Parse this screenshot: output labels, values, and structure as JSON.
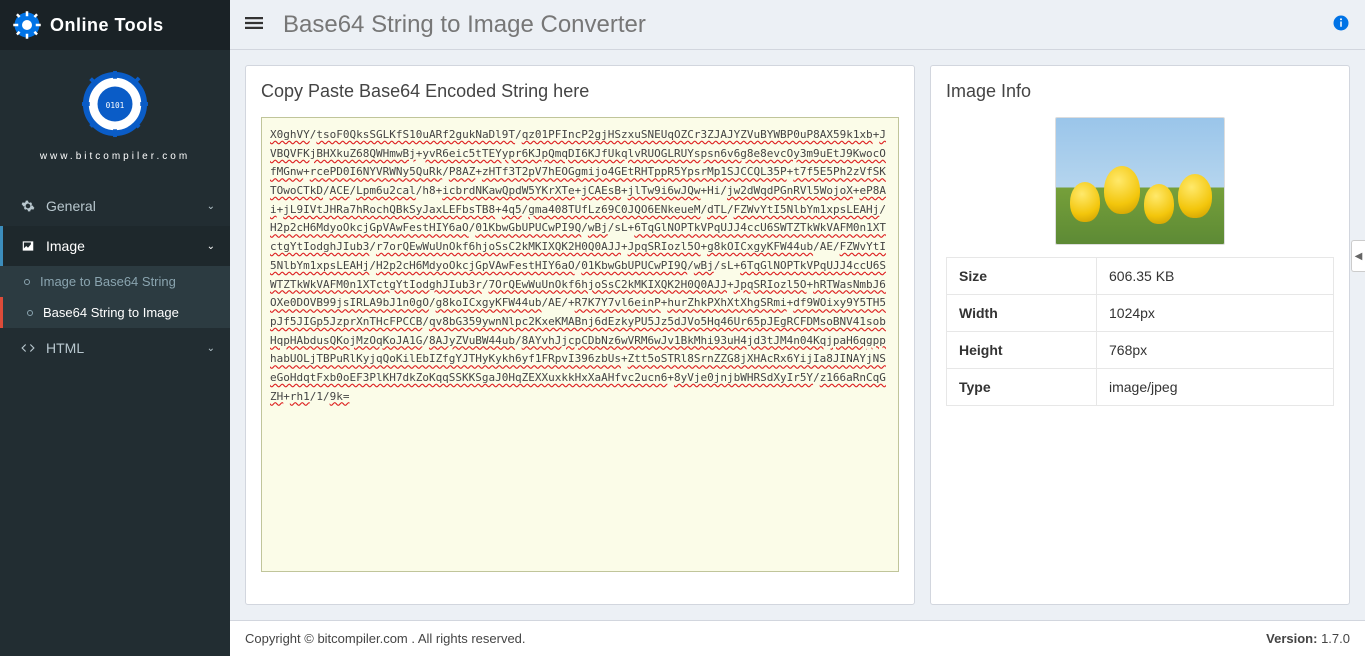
{
  "brand": "Online Tools",
  "site_url": "www.bitcompiler.com",
  "page_title": "Base64 String to Image Converter",
  "sidebar": {
    "items": [
      {
        "label": "General",
        "icon": "gear-icon"
      },
      {
        "label": "Image",
        "icon": "image-icon"
      },
      {
        "label": "HTML",
        "icon": "code-icon"
      }
    ],
    "image_children": [
      {
        "label": "Image to Base64 String"
      },
      {
        "label": "Base64 String to Image"
      }
    ]
  },
  "left_panel": {
    "title": "Copy Paste Base64 Encoded String here",
    "value": "X0ghVY/tsoF0QksSGLKfS10uARf2gukNaDl9T/qz01PFIncP2gjHSzxuSNEUqOZCr3ZJAJYZVuBYWBP0uP8AX59k1xb+JVBQVFKjBHXkuZ68QWHmwBj+yvR6eic5tTEYypr6KJpQmqDI6KJfUkqlvRUOGLRUYspsn6v6g8e8evcOy3m9uEtJ9KwocOfMGnw+rcePD0I6NYVRWNy5QuRk/P8AZ+zHTf3T2pV7hEOGgmijo4GEtRHTppR5YpsrMp1SJCCQL35P+t7f5E5Ph2zVfSKTOwoCTkD/ACE/Lpm6u2cal/h8+icbrdNKawQpdW5YKrXTe+jCAEsB+jlTw9i6wJQw+Hi/jw2dWqdPGnRVl5WojoX+eP8Ai+jL9IVtJHRa7hRochQBkSyJaxLEFbsTB8+4q5/gma408TUfLz69C0JQO6ENkeueM/dTL/FZWvYtI5NlbYm1xpsLEAHj/H2p2cH6MdyoOkcjGpVAwFestHIY6aO/01KbwGbUPUCwPI9Q/wBj/sL+6TqGlNOPTkVPqUJJ4ccU6SWTZTkWkVAFM0n1XTctgYtIodghJIub3/r7orQEwWuUnOkf6hjoSsC2kMKIXQK2H0Q0AJJ+JpqSRIozl5O+g8kOICxgyKFW44ub/AE/FZWvYtI5NlbYm1xpsLEAHj/H2p2cH6MdyoOkcjGpVAwFestHIY6aO/01KbwGbUPUCwPI9Q/wBj/sL+6TqGlNOPTkVPqUJJ4ccU6SWTZTkWkVAFM0n1XTctgYtIodghJIub3r/7OrQEwWuUnOkf6hjoSsC2kMKIXQK2H0Q0AJJ+JpqSRIozl5O+hRTWasNmbJ6OXe0DOVB99jsIRLA9bJ1n0gO/g8koICxgyKFW44ub/AE/+R7K7Y7vl6einP+hurZhkPXhXtXhgSRmi+df9WOixy9Y5TH5pJf5JIGp5JzprXnTHcFPCCB/qv8bG359ywnNlpc2KxeKMABnj6dEzkyPU5Jz5dJVo5Hq46Ur65pJEgRCFDMsoBNV41sobHqpHAbdusQKojMzOqKoJA1G/8AJyZVuBW44ub/8AYvhJjcpCDbNz6wVRM6wJv1BkMhi93uH4jd3tJM4n04KqjpaH6qgpphabUOLjTBPuRlKyjqQoKilEbIZfgYJTHyKykh6yf1FRpvI396zbUs+Ztt5oSTRl8SrnZZG8jXHAcRx6YijIa8JINAYjNSeGoHdqtFxb0oEF3PlKH7dkZoKqqSSKKSgaJ0HqZEXXuxkkHxXaAHfvc2ucn6+8yVje0jnjbWHRSdXyIr5Y/z166aRnCqGZH+rh1/1/9k="
  },
  "right_panel": {
    "title": "Image Info",
    "rows": [
      {
        "k": "Size",
        "v": "606.35 KB"
      },
      {
        "k": "Width",
        "v": "1024px"
      },
      {
        "k": "Height",
        "v": "768px"
      },
      {
        "k": "Type",
        "v": "image/jpeg"
      }
    ]
  },
  "footer": {
    "copyright": "Copyright © bitcompiler.com . All rights reserved.",
    "version_label": "Version:",
    "version": "1.7.0"
  }
}
